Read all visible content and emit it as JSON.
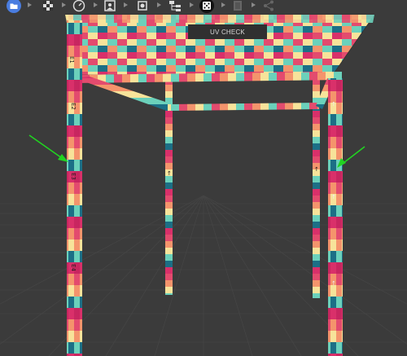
{
  "toolbar": {
    "items": [
      {
        "icon": "folder-icon",
        "active": true
      },
      {
        "icon": "checker-icon"
      },
      {
        "icon": "speedometer-icon"
      },
      {
        "icon": "image-icon"
      },
      {
        "icon": "crop-icon"
      },
      {
        "icon": "hierarchy-icon"
      },
      {
        "icon": "dice-icon",
        "selected": true
      },
      {
        "icon": "layers-icon",
        "disabled": true
      },
      {
        "icon": "share-icon",
        "disabled": true
      }
    ],
    "accent_color": "#4a7de0"
  },
  "viewport": {
    "mode_label": "UV CHECK",
    "background_color": "#3b3b3b",
    "annotation_arrow_color": "#21d421"
  }
}
